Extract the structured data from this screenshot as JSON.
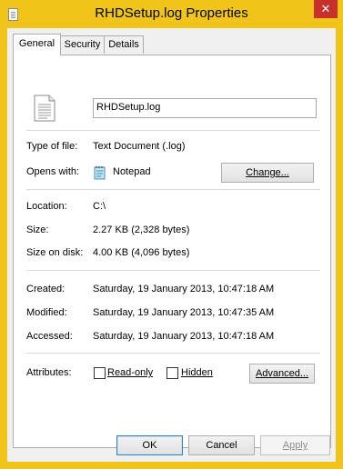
{
  "window": {
    "title": "RHDSetup.log Properties",
    "close_glyph": "✕"
  },
  "tabs": [
    {
      "label": "General"
    },
    {
      "label": "Security"
    },
    {
      "label": "Details"
    }
  ],
  "general": {
    "file_name": "RHDSetup.log",
    "type_label": "Type of file:",
    "type_value": "Text Document (.log)",
    "opens_label": "Opens with:",
    "opens_value": "Notepad",
    "change_button": "Change...",
    "location_label": "Location:",
    "location_value": "C:\\",
    "size_label": "Size:",
    "size_value": "2.27 KB (2,328 bytes)",
    "size_on_disk_label": "Size on disk:",
    "size_on_disk_value": "4.00 KB (4,096 bytes)",
    "created_label": "Created:",
    "created_value": "Saturday, 19 January 2013, 10:47:18 AM",
    "modified_label": "Modified:",
    "modified_value": "Saturday, 19 January 2013, 10:47:35 AM",
    "accessed_label": "Accessed:",
    "accessed_value": "Saturday, 19 January 2013, 10:47:18 AM",
    "attributes_label": "Attributes:",
    "readonly_label": "Read-only",
    "readonly_checked": false,
    "hidden_label": "Hidden",
    "hidden_checked": false,
    "advanced_button": "Advanced..."
  },
  "footer": {
    "ok": "OK",
    "cancel": "Cancel",
    "apply": "Apply"
  },
  "colors": {
    "window_frame": "#f0c419",
    "close_button": "#c7302b"
  }
}
